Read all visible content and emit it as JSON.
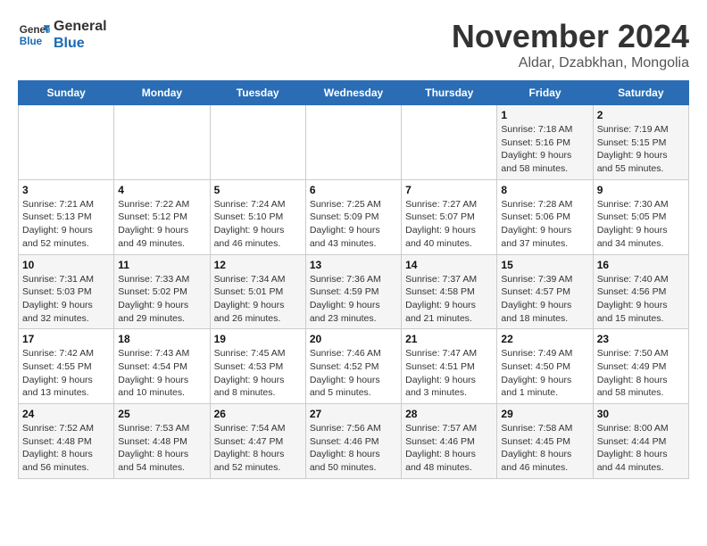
{
  "header": {
    "logo_line1": "General",
    "logo_line2": "Blue",
    "month_title": "November 2024",
    "location": "Aldar, Dzabkhan, Mongolia"
  },
  "weekdays": [
    "Sunday",
    "Monday",
    "Tuesday",
    "Wednesday",
    "Thursday",
    "Friday",
    "Saturday"
  ],
  "weeks": [
    [
      {
        "day": "",
        "info": ""
      },
      {
        "day": "",
        "info": ""
      },
      {
        "day": "",
        "info": ""
      },
      {
        "day": "",
        "info": ""
      },
      {
        "day": "",
        "info": ""
      },
      {
        "day": "1",
        "info": "Sunrise: 7:18 AM\nSunset: 5:16 PM\nDaylight: 9 hours and 58 minutes."
      },
      {
        "day": "2",
        "info": "Sunrise: 7:19 AM\nSunset: 5:15 PM\nDaylight: 9 hours and 55 minutes."
      }
    ],
    [
      {
        "day": "3",
        "info": "Sunrise: 7:21 AM\nSunset: 5:13 PM\nDaylight: 9 hours and 52 minutes."
      },
      {
        "day": "4",
        "info": "Sunrise: 7:22 AM\nSunset: 5:12 PM\nDaylight: 9 hours and 49 minutes."
      },
      {
        "day": "5",
        "info": "Sunrise: 7:24 AM\nSunset: 5:10 PM\nDaylight: 9 hours and 46 minutes."
      },
      {
        "day": "6",
        "info": "Sunrise: 7:25 AM\nSunset: 5:09 PM\nDaylight: 9 hours and 43 minutes."
      },
      {
        "day": "7",
        "info": "Sunrise: 7:27 AM\nSunset: 5:07 PM\nDaylight: 9 hours and 40 minutes."
      },
      {
        "day": "8",
        "info": "Sunrise: 7:28 AM\nSunset: 5:06 PM\nDaylight: 9 hours and 37 minutes."
      },
      {
        "day": "9",
        "info": "Sunrise: 7:30 AM\nSunset: 5:05 PM\nDaylight: 9 hours and 34 minutes."
      }
    ],
    [
      {
        "day": "10",
        "info": "Sunrise: 7:31 AM\nSunset: 5:03 PM\nDaylight: 9 hours and 32 minutes."
      },
      {
        "day": "11",
        "info": "Sunrise: 7:33 AM\nSunset: 5:02 PM\nDaylight: 9 hours and 29 minutes."
      },
      {
        "day": "12",
        "info": "Sunrise: 7:34 AM\nSunset: 5:01 PM\nDaylight: 9 hours and 26 minutes."
      },
      {
        "day": "13",
        "info": "Sunrise: 7:36 AM\nSunset: 4:59 PM\nDaylight: 9 hours and 23 minutes."
      },
      {
        "day": "14",
        "info": "Sunrise: 7:37 AM\nSunset: 4:58 PM\nDaylight: 9 hours and 21 minutes."
      },
      {
        "day": "15",
        "info": "Sunrise: 7:39 AM\nSunset: 4:57 PM\nDaylight: 9 hours and 18 minutes."
      },
      {
        "day": "16",
        "info": "Sunrise: 7:40 AM\nSunset: 4:56 PM\nDaylight: 9 hours and 15 minutes."
      }
    ],
    [
      {
        "day": "17",
        "info": "Sunrise: 7:42 AM\nSunset: 4:55 PM\nDaylight: 9 hours and 13 minutes."
      },
      {
        "day": "18",
        "info": "Sunrise: 7:43 AM\nSunset: 4:54 PM\nDaylight: 9 hours and 10 minutes."
      },
      {
        "day": "19",
        "info": "Sunrise: 7:45 AM\nSunset: 4:53 PM\nDaylight: 9 hours and 8 minutes."
      },
      {
        "day": "20",
        "info": "Sunrise: 7:46 AM\nSunset: 4:52 PM\nDaylight: 9 hours and 5 minutes."
      },
      {
        "day": "21",
        "info": "Sunrise: 7:47 AM\nSunset: 4:51 PM\nDaylight: 9 hours and 3 minutes."
      },
      {
        "day": "22",
        "info": "Sunrise: 7:49 AM\nSunset: 4:50 PM\nDaylight: 9 hours and 1 minute."
      },
      {
        "day": "23",
        "info": "Sunrise: 7:50 AM\nSunset: 4:49 PM\nDaylight: 8 hours and 58 minutes."
      }
    ],
    [
      {
        "day": "24",
        "info": "Sunrise: 7:52 AM\nSunset: 4:48 PM\nDaylight: 8 hours and 56 minutes."
      },
      {
        "day": "25",
        "info": "Sunrise: 7:53 AM\nSunset: 4:48 PM\nDaylight: 8 hours and 54 minutes."
      },
      {
        "day": "26",
        "info": "Sunrise: 7:54 AM\nSunset: 4:47 PM\nDaylight: 8 hours and 52 minutes."
      },
      {
        "day": "27",
        "info": "Sunrise: 7:56 AM\nSunset: 4:46 PM\nDaylight: 8 hours and 50 minutes."
      },
      {
        "day": "28",
        "info": "Sunrise: 7:57 AM\nSunset: 4:46 PM\nDaylight: 8 hours and 48 minutes."
      },
      {
        "day": "29",
        "info": "Sunrise: 7:58 AM\nSunset: 4:45 PM\nDaylight: 8 hours and 46 minutes."
      },
      {
        "day": "30",
        "info": "Sunrise: 8:00 AM\nSunset: 4:44 PM\nDaylight: 8 hours and 44 minutes."
      }
    ]
  ]
}
